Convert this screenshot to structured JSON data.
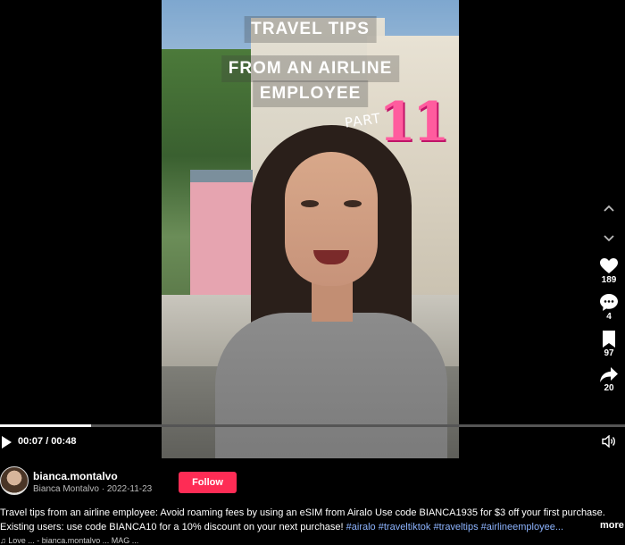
{
  "video": {
    "overlay_line1": "TRAVEL TIPS",
    "overlay_line2": "FROM AN AIRLINE",
    "overlay_line3": "EMPLOYEE",
    "part_label": "PART",
    "part_number": "11",
    "progress_fraction": 0.146
  },
  "actions": {
    "likes": "189",
    "comments": "4",
    "saves": "97",
    "shares": "20",
    "scroll_up_icon": "chevron-up-icon",
    "scroll_down_icon": "chevron-down-icon"
  },
  "player": {
    "time": "00:07 / 00:48"
  },
  "author": {
    "username": "bianca.montalvo",
    "display_name": "Bianca Montalvo",
    "date": "2022-11-23",
    "follow_label": "Follow"
  },
  "description": {
    "line1": "Travel tips from an airline employee: Avoid roaming fees by using an eSIM from Airalo Use code BIANCA1935 for $3 off your first purchase.",
    "line2_text": "Existing users: use code BIANCA10 for a 10% discount on your next purchase! ",
    "hashtags": "#airalo #traveltiktok #traveltips #airlineemployee...",
    "more_label": "more",
    "music": "♫ Love ... - bianca.montalvo ... MAG ..."
  },
  "colors": {
    "follow": "#fe2c55",
    "hashtag": "#8db4ff",
    "part_number": "#ff5c9e"
  }
}
